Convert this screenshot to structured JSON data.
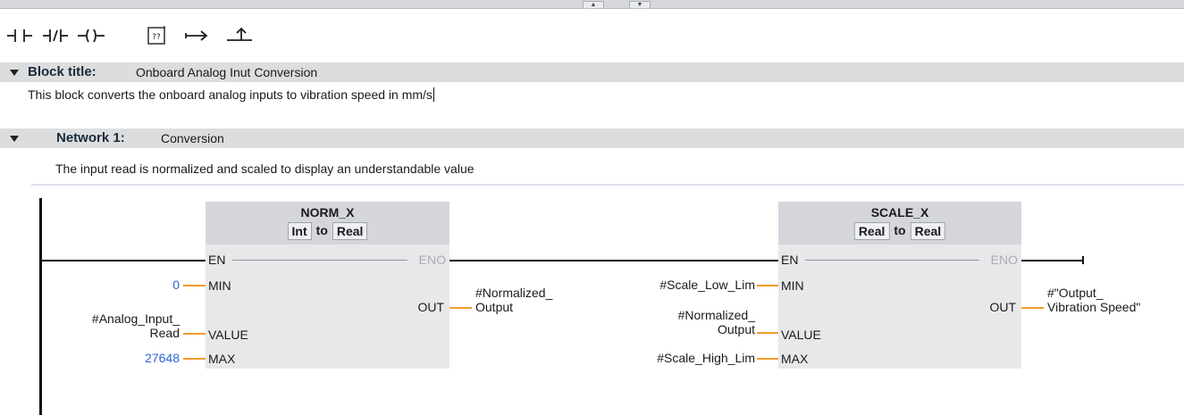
{
  "toolbar": {
    "tools": [
      {
        "icon": "normally-open-contact-icon"
      },
      {
        "icon": "normally-closed-contact-icon"
      },
      {
        "icon": "output-coil-icon"
      },
      {
        "icon": "empty-box-icon",
        "text": "??"
      },
      {
        "icon": "open-branch-icon"
      },
      {
        "icon": "close-branch-icon"
      }
    ]
  },
  "block": {
    "title_label": "Block title:",
    "title_value": "Onboard Analog Inut Conversion",
    "comment": "This block converts the onboard analog inputs to vibration speed in mm/s"
  },
  "network": {
    "label": "Network 1:",
    "title": "Conversion",
    "comment": "The input read is normalized and scaled to display an understandable value"
  },
  "norm_x": {
    "name": "NORM_X",
    "type_from": "Int",
    "type_to_word": "to",
    "type_to": "Real",
    "pin_en": "EN",
    "pin_eno": "ENO",
    "pin_min": "MIN",
    "pin_value": "VALUE",
    "pin_max": "MAX",
    "pin_out": "OUT",
    "min_operand": "0",
    "value_operand_line1": "#Analog_Input_",
    "value_operand_line2": "Read",
    "max_operand": "27648",
    "out_operand_line1": "#Normalized_",
    "out_operand_line2": "Output"
  },
  "scale_x": {
    "name": "SCALE_X",
    "type_from": "Real",
    "type_to_word": "to",
    "type_to": "Real",
    "pin_en": "EN",
    "pin_eno": "ENO",
    "pin_min": "MIN",
    "pin_value": "VALUE",
    "pin_max": "MAX",
    "pin_out": "OUT",
    "min_operand": "#Scale_Low_Lim",
    "value_operand_line1": "#Normalized_",
    "value_operand_line2": "Output",
    "max_operand": "#Scale_High_Lim",
    "out_operand_line1": "#\"Output_",
    "out_operand_line2": "Vibration Speed\""
  },
  "colors": {
    "operand_wire": "#f39c2b",
    "constant_value": "#2b64d8",
    "header_band": "#dcdddf",
    "block_body": "#e8e8eb"
  }
}
